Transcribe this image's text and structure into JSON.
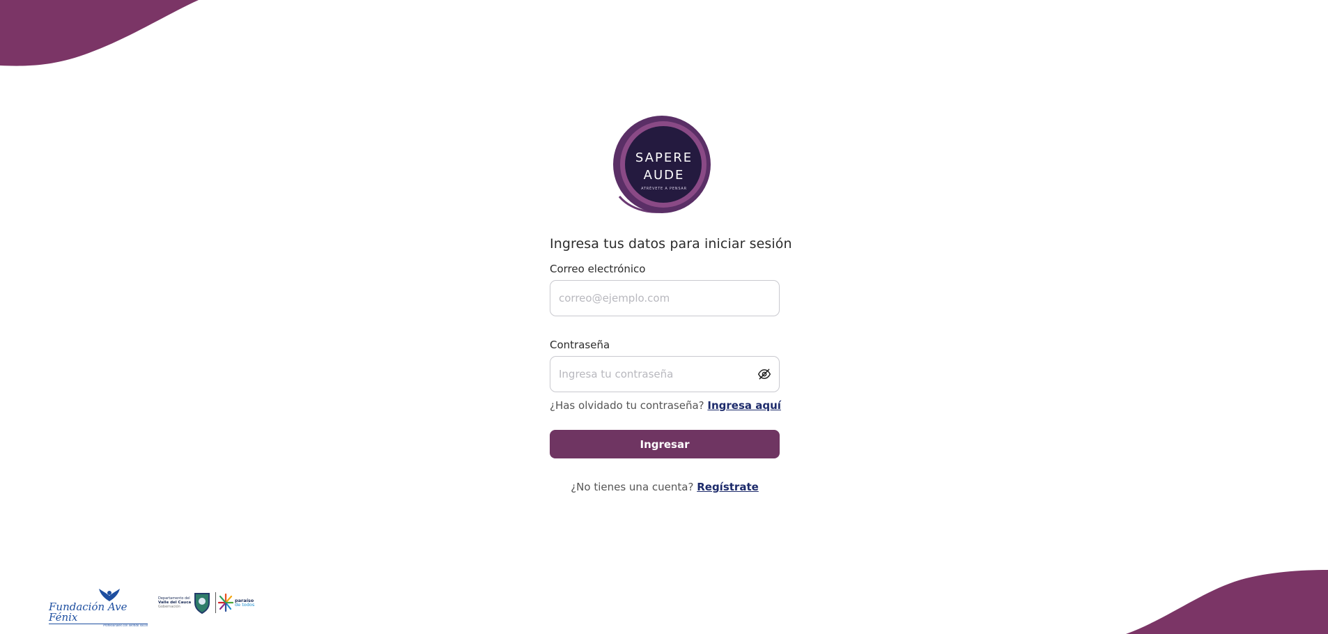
{
  "brand": {
    "logo_line1": "SAPERE",
    "logo_line2": "AUDE",
    "logo_tagline": "ATRÉVETE A PENSAR",
    "primary_color": "#6f3562",
    "wave_color": "#7b3566",
    "logo_dark": "#241a3f",
    "logo_ring": "#6b3a73"
  },
  "login": {
    "heading": "Ingresa tus datos para iniciar sesión",
    "email_label": "Correo electrónico",
    "email_placeholder": "correo@ejemplo.com",
    "email_value": "",
    "password_label": "Contraseña",
    "password_placeholder": "Ingresa tu contraseña",
    "password_value": "",
    "password_toggle_icon": "eye-off-icon",
    "forgot_prompt": "¿Has olvidado tu contraseña?",
    "forgot_link": "Ingresa aquí",
    "submit_label": "Ingresar",
    "register_prompt": "¿No tienes una cuenta?",
    "register_link": "Regístrate",
    "link_color": "#1d2b6b"
  },
  "footer": {
    "fenix_name": "Fundación Ave Fénix",
    "fenix_slogan": "Profesionales con sentido social",
    "valle_line1": "Departamento del",
    "valle_line2": "Valle del Cauca",
    "valle_line3": "Gobernación",
    "paraiso_line1": "paraíso",
    "paraiso_line2": "de todos"
  }
}
